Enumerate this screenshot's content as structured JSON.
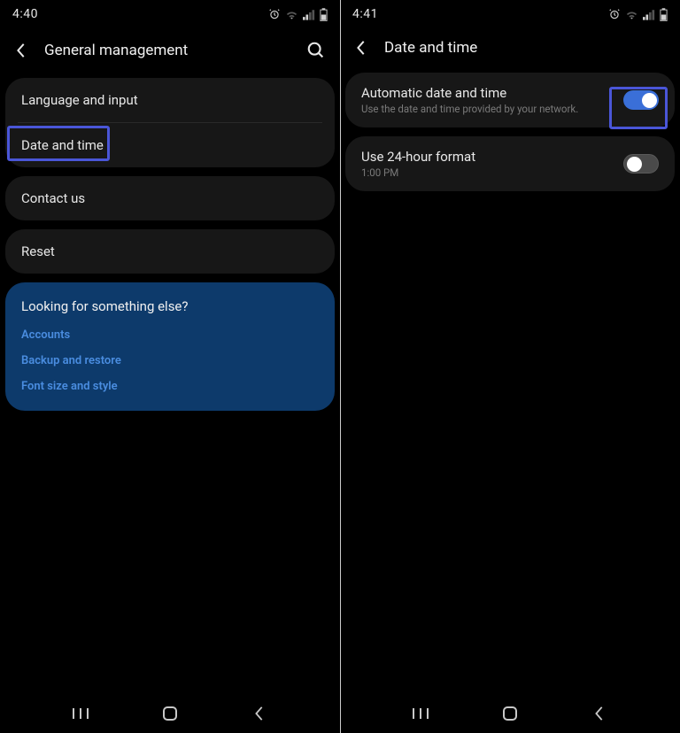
{
  "left": {
    "status_time": "4:40",
    "header_title": "General management",
    "items": {
      "language": "Language and input",
      "date_time": "Date and time",
      "contact": "Contact us",
      "reset": "Reset"
    },
    "tips": {
      "title": "Looking for something else?",
      "links": {
        "accounts": "Accounts",
        "backup": "Backup and restore",
        "font": "Font size and style"
      }
    }
  },
  "right": {
    "status_time": "4:41",
    "header_title": "Date and time",
    "auto": {
      "label": "Automatic date and time",
      "sub": "Use the date and time provided by your network."
    },
    "format24": {
      "label": "Use 24-hour format",
      "sub": "1:00 PM"
    }
  }
}
